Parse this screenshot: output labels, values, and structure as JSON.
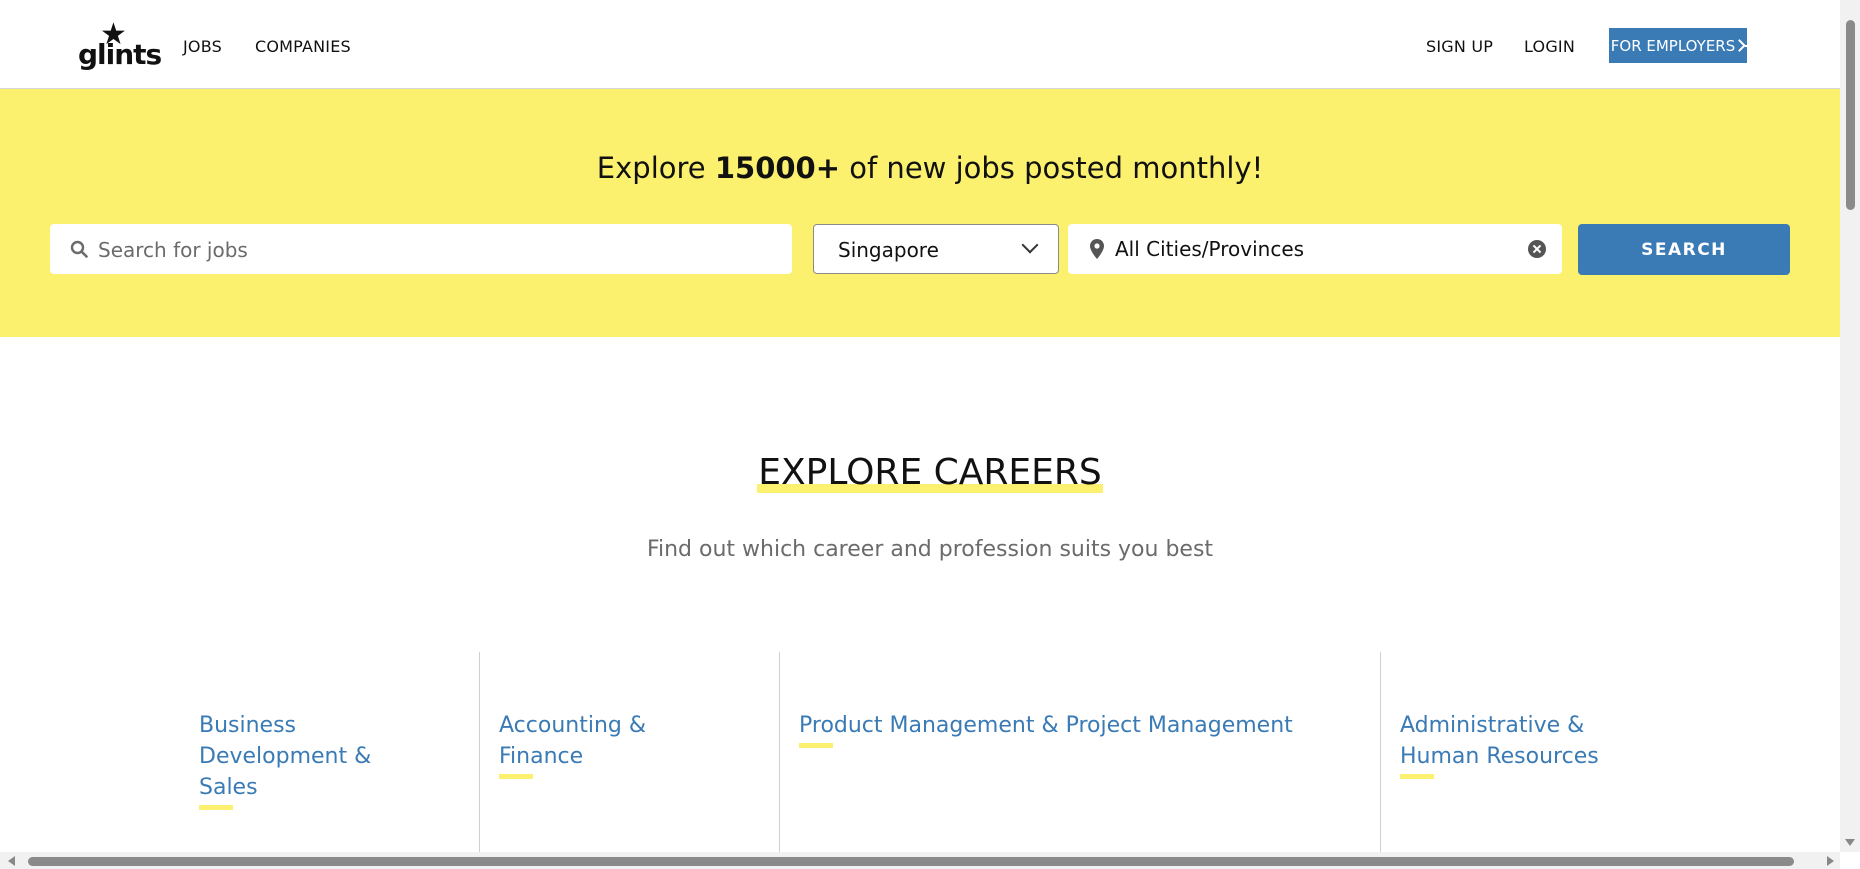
{
  "header": {
    "logo_text": "glints",
    "nav": {
      "jobs": "JOBS",
      "companies": "COMPANIES",
      "sign_up": "SIGN UP",
      "login": "LOGIN",
      "for_employers": "FOR EMPLOYERS"
    }
  },
  "hero": {
    "title_prefix": "Explore ",
    "title_highlight": "15000+",
    "title_suffix": " of new jobs posted monthly!",
    "search": {
      "placeholder": "Search for jobs",
      "value": ""
    },
    "country_select": {
      "value": "Singapore"
    },
    "city_select": {
      "value": "All Cities/Provinces"
    },
    "search_button": "SEARCH"
  },
  "careers": {
    "title": "EXPLORE CAREERS",
    "subtitle": "Find out which career and profession suits you best",
    "categories": [
      {
        "label_lines": [
          "Business",
          "Development &",
          "Sales"
        ]
      },
      {
        "label_lines": [
          "Accounting &",
          "Finance"
        ]
      },
      {
        "label_lines": [
          "Product Management & Project Management"
        ]
      },
      {
        "label_lines": [
          "Administrative &",
          "Human Resources"
        ]
      }
    ]
  },
  "colors": {
    "accent_blue": "#3a7ab5",
    "brand_yellow": "#fcf16e"
  },
  "icons": [
    "star-logo-icon",
    "arrow-right-icon",
    "search-icon",
    "chevron-down-icon",
    "location-pin-icon",
    "clear-icon"
  ]
}
